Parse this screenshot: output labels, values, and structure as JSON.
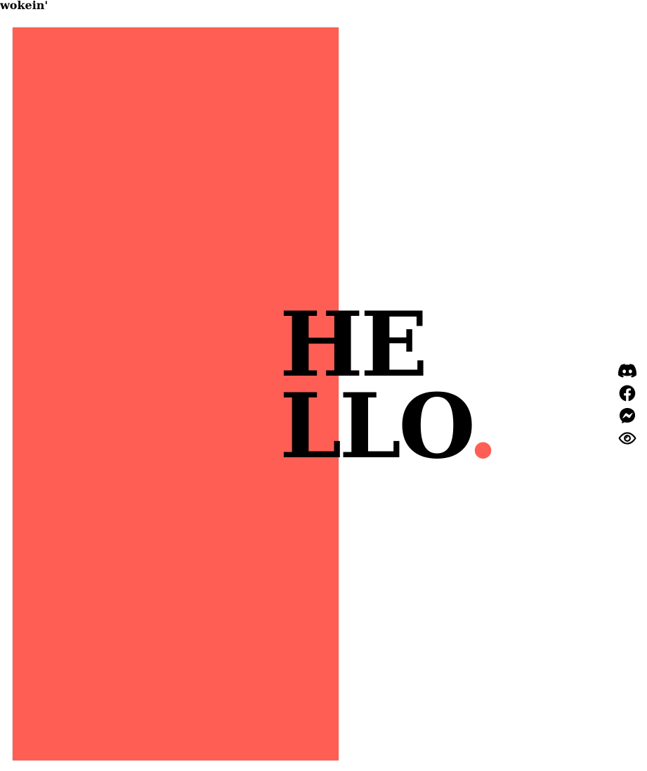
{
  "brand": {
    "text": "wokein'"
  },
  "hero": {
    "line1": "HE",
    "line2": "LLO",
    "dot": "."
  },
  "colors": {
    "accent": "#ff5e55",
    "text": "#000000",
    "background": "#ffffff"
  },
  "socials": [
    {
      "icon": "discord-icon"
    },
    {
      "icon": "facebook-icon"
    },
    {
      "icon": "messenger-icon"
    },
    {
      "icon": "eye-icon"
    }
  ]
}
